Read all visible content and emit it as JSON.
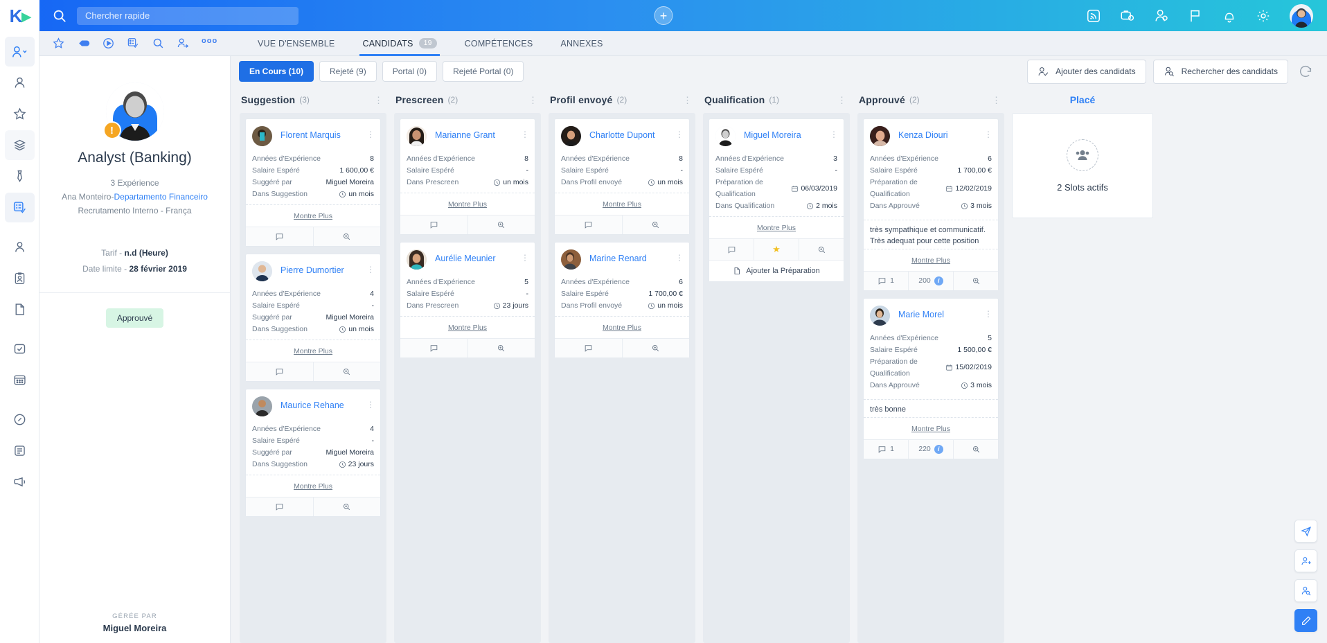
{
  "topbar": {
    "logo_text": "K",
    "search_placeholder": "Chercher rapide",
    "search_value": "",
    "add_label": "+",
    "icons": [
      "rss-icon",
      "briefcase-icon",
      "user-add-icon",
      "flag-icon",
      "bell-icon",
      "gear-icon",
      "avatar"
    ]
  },
  "quick_icons": [
    "star-icon",
    "diamond-icon",
    "play-circle-icon",
    "list-check-icon",
    "search-icon",
    "user-arrow-icon",
    "more-dots-icon"
  ],
  "tabs": [
    {
      "label": "VUE D'ENSEMBLE",
      "count": "",
      "active": false
    },
    {
      "label": "CANDIDATS",
      "count": "19",
      "active": true
    },
    {
      "label": "COMPÉTENCES",
      "count": "",
      "active": false
    },
    {
      "label": "ANNEXES",
      "count": "",
      "active": false
    }
  ],
  "job": {
    "title": "Analyst (Banking)",
    "experience": "3 Expérience",
    "owner_prefix": "Ana Monteiro-",
    "department": "Departamento Financeiro",
    "recruitment": "Recrutamento Interno  -  França",
    "rate_label": "Tarif  -  ",
    "rate_value": "n.d  (Heure)",
    "deadline_label": "Date limite  -  ",
    "deadline_value": "28 février 2019",
    "status_chip": "Approuvé",
    "managed_by_label": "GÉRÉE PAR",
    "managed_by_name": "Miguel Moreira",
    "warn_badge": "!"
  },
  "filters": [
    {
      "label": "En Cours (10)",
      "active": true
    },
    {
      "label": "Rejeté (9)",
      "active": false
    },
    {
      "label": "Portal (0)",
      "active": false
    },
    {
      "label": "Rejeté Portal (0)",
      "active": false
    }
  ],
  "header_buttons": [
    {
      "label": "Ajouter des candidats",
      "icon": "user-check-icon"
    },
    {
      "label": "Rechercher des candidats",
      "icon": "user-search-icon"
    }
  ],
  "refresh_icon": "refresh-icon",
  "columns": [
    {
      "name": "Suggestion",
      "count": "(3)",
      "cards": [
        {
          "name": "Florent Marquis",
          "rows": [
            {
              "label": "Années d'Expérience",
              "value": "8",
              "icon": ""
            },
            {
              "label": "Salaire Espéré",
              "value": "1 600,00 €",
              "icon": ""
            },
            {
              "label": "Suggéré par",
              "value": "Miguel Moreira",
              "icon": ""
            },
            {
              "label": "Dans Suggestion",
              "value": "un mois",
              "icon": "clock"
            }
          ],
          "note": "",
          "more": "Montre Plus",
          "actions": [
            {
              "icon": "comment-icon",
              "label": ""
            },
            {
              "icon": "zoom-icon",
              "label": ""
            }
          ]
        },
        {
          "name": "Pierre Dumortier",
          "rows": [
            {
              "label": "Années d'Expérience",
              "value": "4",
              "icon": ""
            },
            {
              "label": "Salaire Espéré",
              "value": "-",
              "icon": ""
            },
            {
              "label": "Suggéré par",
              "value": "Miguel Moreira",
              "icon": ""
            },
            {
              "label": "Dans Suggestion",
              "value": "un mois",
              "icon": "clock"
            }
          ],
          "note": "",
          "more": "Montre Plus",
          "actions": [
            {
              "icon": "comment-icon",
              "label": ""
            },
            {
              "icon": "zoom-icon",
              "label": ""
            }
          ]
        },
        {
          "name": "Maurice Rehane",
          "rows": [
            {
              "label": "Années d'Expérience",
              "value": "4",
              "icon": ""
            },
            {
              "label": "Salaire Espéré",
              "value": "-",
              "icon": ""
            },
            {
              "label": "Suggéré par",
              "value": "Miguel Moreira",
              "icon": ""
            },
            {
              "label": "Dans Suggestion",
              "value": "23 jours",
              "icon": "clock"
            }
          ],
          "note": "",
          "more": "Montre Plus",
          "actions": [
            {
              "icon": "comment-icon",
              "label": ""
            },
            {
              "icon": "zoom-icon",
              "label": ""
            }
          ]
        }
      ]
    },
    {
      "name": "Prescreen",
      "count": "(2)",
      "cards": [
        {
          "name": "Marianne Grant",
          "rows": [
            {
              "label": "Années d'Expérience",
              "value": "8",
              "icon": ""
            },
            {
              "label": "Salaire Espéré",
              "value": "-",
              "icon": ""
            },
            {
              "label": "Dans Prescreen",
              "value": "un mois",
              "icon": "clock"
            }
          ],
          "note": "",
          "more": "Montre Plus",
          "actions": [
            {
              "icon": "comment-icon",
              "label": ""
            },
            {
              "icon": "zoom-icon",
              "label": ""
            }
          ]
        },
        {
          "name": "Aurélie Meunier",
          "rows": [
            {
              "label": "Années d'Expérience",
              "value": "5",
              "icon": ""
            },
            {
              "label": "Salaire Espéré",
              "value": "-",
              "icon": ""
            },
            {
              "label": "Dans Prescreen",
              "value": "23 jours",
              "icon": "clock"
            }
          ],
          "note": "",
          "more": "Montre Plus",
          "actions": [
            {
              "icon": "comment-icon",
              "label": ""
            },
            {
              "icon": "zoom-icon",
              "label": ""
            }
          ]
        }
      ]
    },
    {
      "name": "Profil envoyé",
      "count": "(2)",
      "cards": [
        {
          "name": "Charlotte Dupont",
          "rows": [
            {
              "label": "Années d'Expérience",
              "value": "8",
              "icon": ""
            },
            {
              "label": "Salaire Espéré",
              "value": "-",
              "icon": ""
            },
            {
              "label": "Dans Profil envoyé",
              "value": "un mois",
              "icon": "clock"
            }
          ],
          "note": "",
          "more": "Montre Plus",
          "actions": [
            {
              "icon": "comment-icon",
              "label": ""
            },
            {
              "icon": "zoom-icon",
              "label": ""
            }
          ]
        },
        {
          "name": "Marine Renard",
          "rows": [
            {
              "label": "Années d'Expérience",
              "value": "6",
              "icon": ""
            },
            {
              "label": "Salaire Espéré",
              "value": "1 700,00 €",
              "icon": ""
            },
            {
              "label": "Dans Profil envoyé",
              "value": "un mois",
              "icon": "clock"
            }
          ],
          "note": "",
          "more": "Montre Plus",
          "actions": [
            {
              "icon": "comment-icon",
              "label": ""
            },
            {
              "icon": "zoom-icon",
              "label": ""
            }
          ]
        }
      ]
    },
    {
      "name": "Qualification",
      "count": "(1)",
      "cards": [
        {
          "name": "Miguel Moreira",
          "rows": [
            {
              "label": "Années d'Expérience",
              "value": "3",
              "icon": ""
            },
            {
              "label": "Salaire Espéré",
              "value": "-",
              "icon": ""
            },
            {
              "label": "Préparation de Qualification",
              "value": "06/03/2019",
              "icon": "calendar"
            },
            {
              "label": "Dans Qualification",
              "value": "2 mois",
              "icon": "clock"
            }
          ],
          "note": "",
          "more": "Montre Plus",
          "actions": [
            {
              "icon": "comment-icon",
              "label": ""
            },
            {
              "icon": "star-icon",
              "label": ""
            },
            {
              "icon": "zoom-icon",
              "label": ""
            }
          ],
          "prep_button": "Ajouter la Préparation"
        }
      ]
    },
    {
      "name": "Approuvé",
      "count": "(2)",
      "cards": [
        {
          "name": "Kenza Diouri",
          "rows": [
            {
              "label": "Années d'Expérience",
              "value": "6",
              "icon": ""
            },
            {
              "label": "Salaire Espéré",
              "value": "1 700,00 €",
              "icon": ""
            },
            {
              "label": "Préparation de Qualification",
              "value": "12/02/2019",
              "icon": "calendar"
            },
            {
              "label": "Dans Approuvé",
              "value": "3 mois",
              "icon": "clock"
            }
          ],
          "note": "très sympathique et communicatif. Très adequat pour cette position",
          "more": "Montre Plus",
          "actions": [
            {
              "icon": "comment-icon",
              "label": "1"
            },
            {
              "icon": "score-icon",
              "label": "200"
            },
            {
              "icon": "zoom-icon",
              "label": ""
            }
          ]
        },
        {
          "name": "Marie Morel",
          "rows": [
            {
              "label": "Années d'Expérience",
              "value": "5",
              "icon": ""
            },
            {
              "label": "Salaire Espéré",
              "value": "1 500,00 €",
              "icon": ""
            },
            {
              "label": "Préparation de Qualification",
              "value": "15/02/2019",
              "icon": "calendar"
            },
            {
              "label": "Dans Approuvé",
              "value": "3 mois",
              "icon": "clock"
            }
          ],
          "note": "très bonne",
          "more": "Montre Plus",
          "actions": [
            {
              "icon": "comment-icon",
              "label": "1"
            },
            {
              "icon": "score-icon",
              "label": "220"
            },
            {
              "icon": "zoom-icon",
              "label": ""
            }
          ]
        }
      ]
    }
  ],
  "placed": {
    "title": "Placé",
    "slots_text": "2 Slots actifs",
    "icon": "people-icon"
  },
  "fabs": [
    {
      "icon": "send-icon",
      "primary": false
    },
    {
      "icon": "user-plus-icon",
      "primary": false
    },
    {
      "icon": "user-search-icon",
      "primary": false
    },
    {
      "icon": "edit-icon",
      "primary": true
    }
  ],
  "colors": {
    "accent": "#2f80f5",
    "active_tab": "#1f6fe5",
    "board_bg": "#e7ebf0",
    "warn": "#f5a623",
    "chip_green": "#d7f5e4",
    "star": "#f2c024"
  }
}
